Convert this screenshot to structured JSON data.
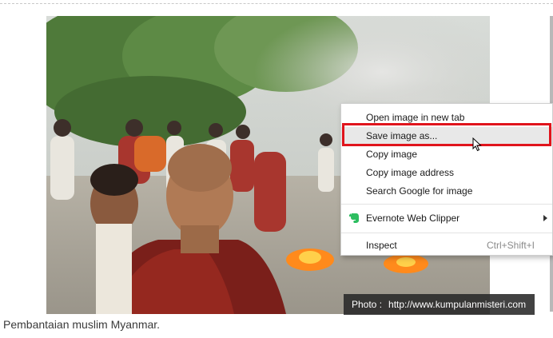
{
  "photo": {
    "alt_subject": "monks"
  },
  "credit": {
    "prefix": "Photo :",
    "url": "http://www.kumpulanmisteri.com"
  },
  "caption": "Pembantaian muslim Myanmar.",
  "context_menu": {
    "open_new_tab": "Open image in new tab",
    "save_as": "Save image as...",
    "copy_image": "Copy image",
    "copy_address": "Copy image address",
    "search_google": "Search Google for image",
    "evernote": "Evernote Web Clipper",
    "inspect": "Inspect",
    "inspect_shortcut": "Ctrl+Shift+I"
  },
  "colors": {
    "highlight_border": "#e0141c",
    "evernote_green": "#2dbe60",
    "credit_bg": "#282828"
  }
}
